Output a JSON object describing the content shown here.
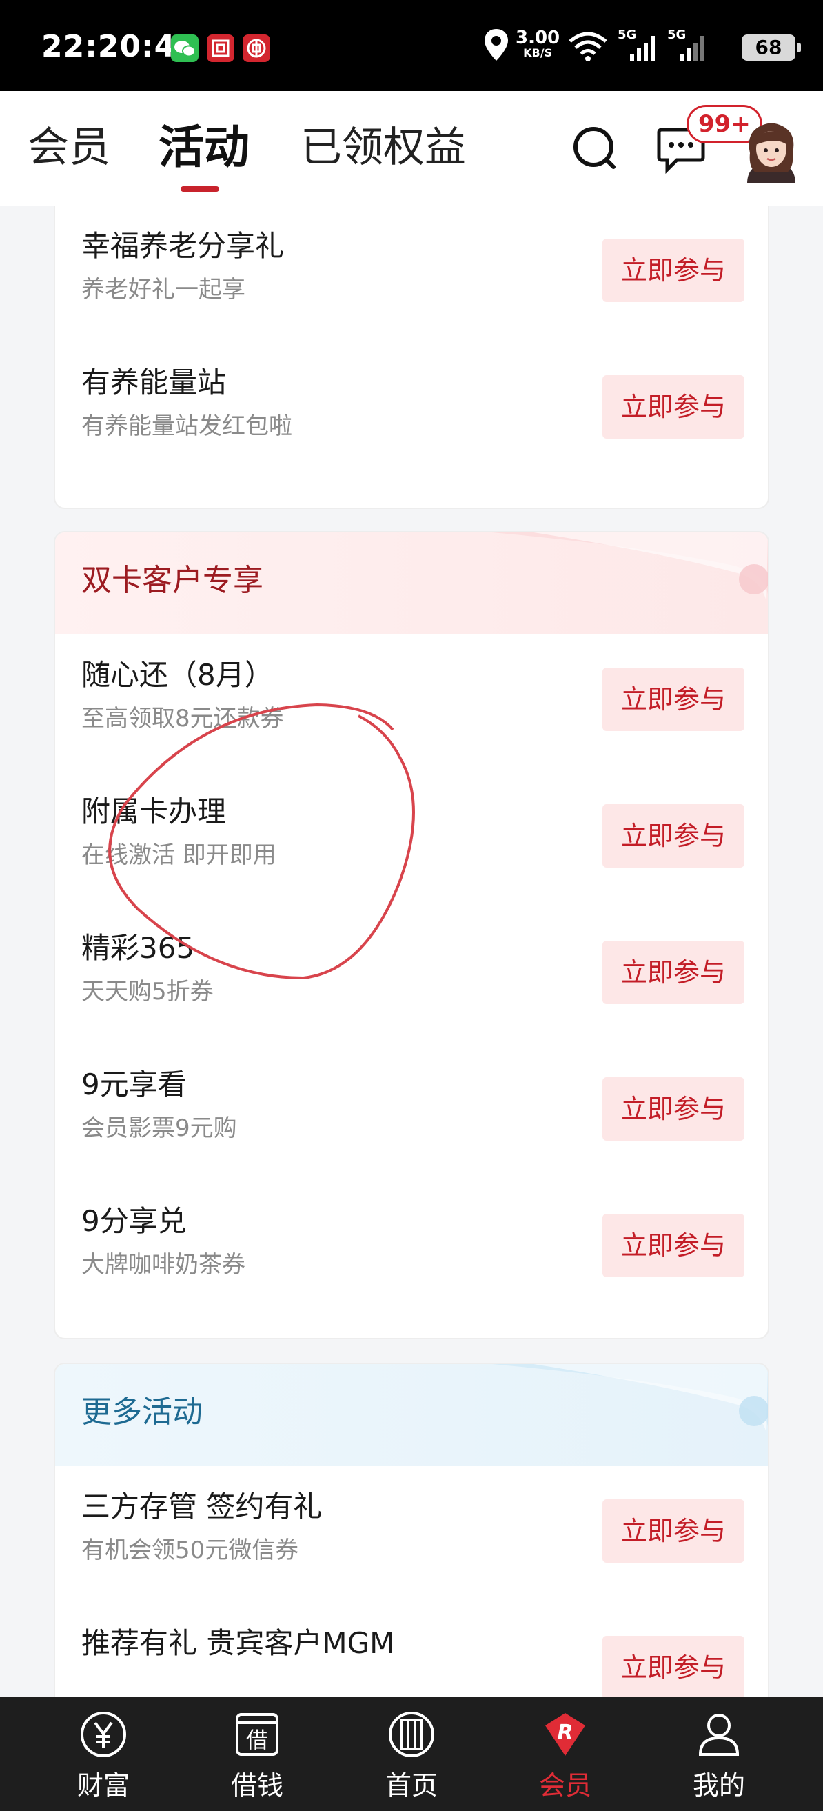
{
  "status_bar": {
    "time": "22:20:48",
    "network_speed": "3.00",
    "speed_unit": "KB/S",
    "signal1": "5G",
    "signal2": "5G",
    "battery": "68",
    "app_icons": [
      "wechat-icon",
      "bank-app-icon",
      "bank-app-icon-2"
    ]
  },
  "top_nav": {
    "tabs": [
      "会员",
      "活动",
      "已领权益"
    ],
    "active_tab": "活动",
    "message_badge": "99+"
  },
  "list_top": {
    "items": [
      {
        "title": "幸福养老分享礼",
        "subtitle": "养老好礼一起享",
        "button": "立即参与"
      },
      {
        "title": "有养能量站",
        "subtitle": "有养能量站发红包啦",
        "button": "立即参与"
      }
    ]
  },
  "dual_card": {
    "title": "双卡客户专享",
    "items": [
      {
        "title": "随心还（8月）",
        "subtitle": "至高领取8元还款券",
        "button": "立即参与"
      },
      {
        "title": "附属卡办理",
        "subtitle": "在线激活 即开即用",
        "button": "立即参与"
      },
      {
        "title": "精彩365",
        "subtitle": "天天购5折券",
        "button": "立即参与"
      },
      {
        "title": "9元享看",
        "subtitle": "会员影票9元购",
        "button": "立即参与"
      },
      {
        "title": "9分享兑",
        "subtitle": "大牌咖啡奶茶券",
        "button": "立即参与"
      }
    ]
  },
  "more_activities": {
    "title": "更多活动",
    "items": [
      {
        "title": "三方存管 签约有礼",
        "subtitle": "有机会领50元微信券",
        "button": "立即参与"
      },
      {
        "title": "推荐有礼 贵宾客户MGM",
        "subtitle": "",
        "button": "立即参与"
      }
    ]
  },
  "bottom_nav": {
    "items": [
      {
        "label": "财富",
        "icon": "yen-icon"
      },
      {
        "label": "借钱",
        "icon": "borrow-icon",
        "icon_text": "借"
      },
      {
        "label": "首页",
        "icon": "home-icon"
      },
      {
        "label": "会员",
        "icon": "member-r-icon",
        "icon_text": "R"
      },
      {
        "label": "我的",
        "icon": "person-icon"
      }
    ],
    "active": "会员"
  },
  "colors": {
    "accent_red": "#c8232c",
    "button_bg": "#fde7e7",
    "section_red_title": "#9c1b21",
    "section_blue_title": "#1e6a92"
  }
}
